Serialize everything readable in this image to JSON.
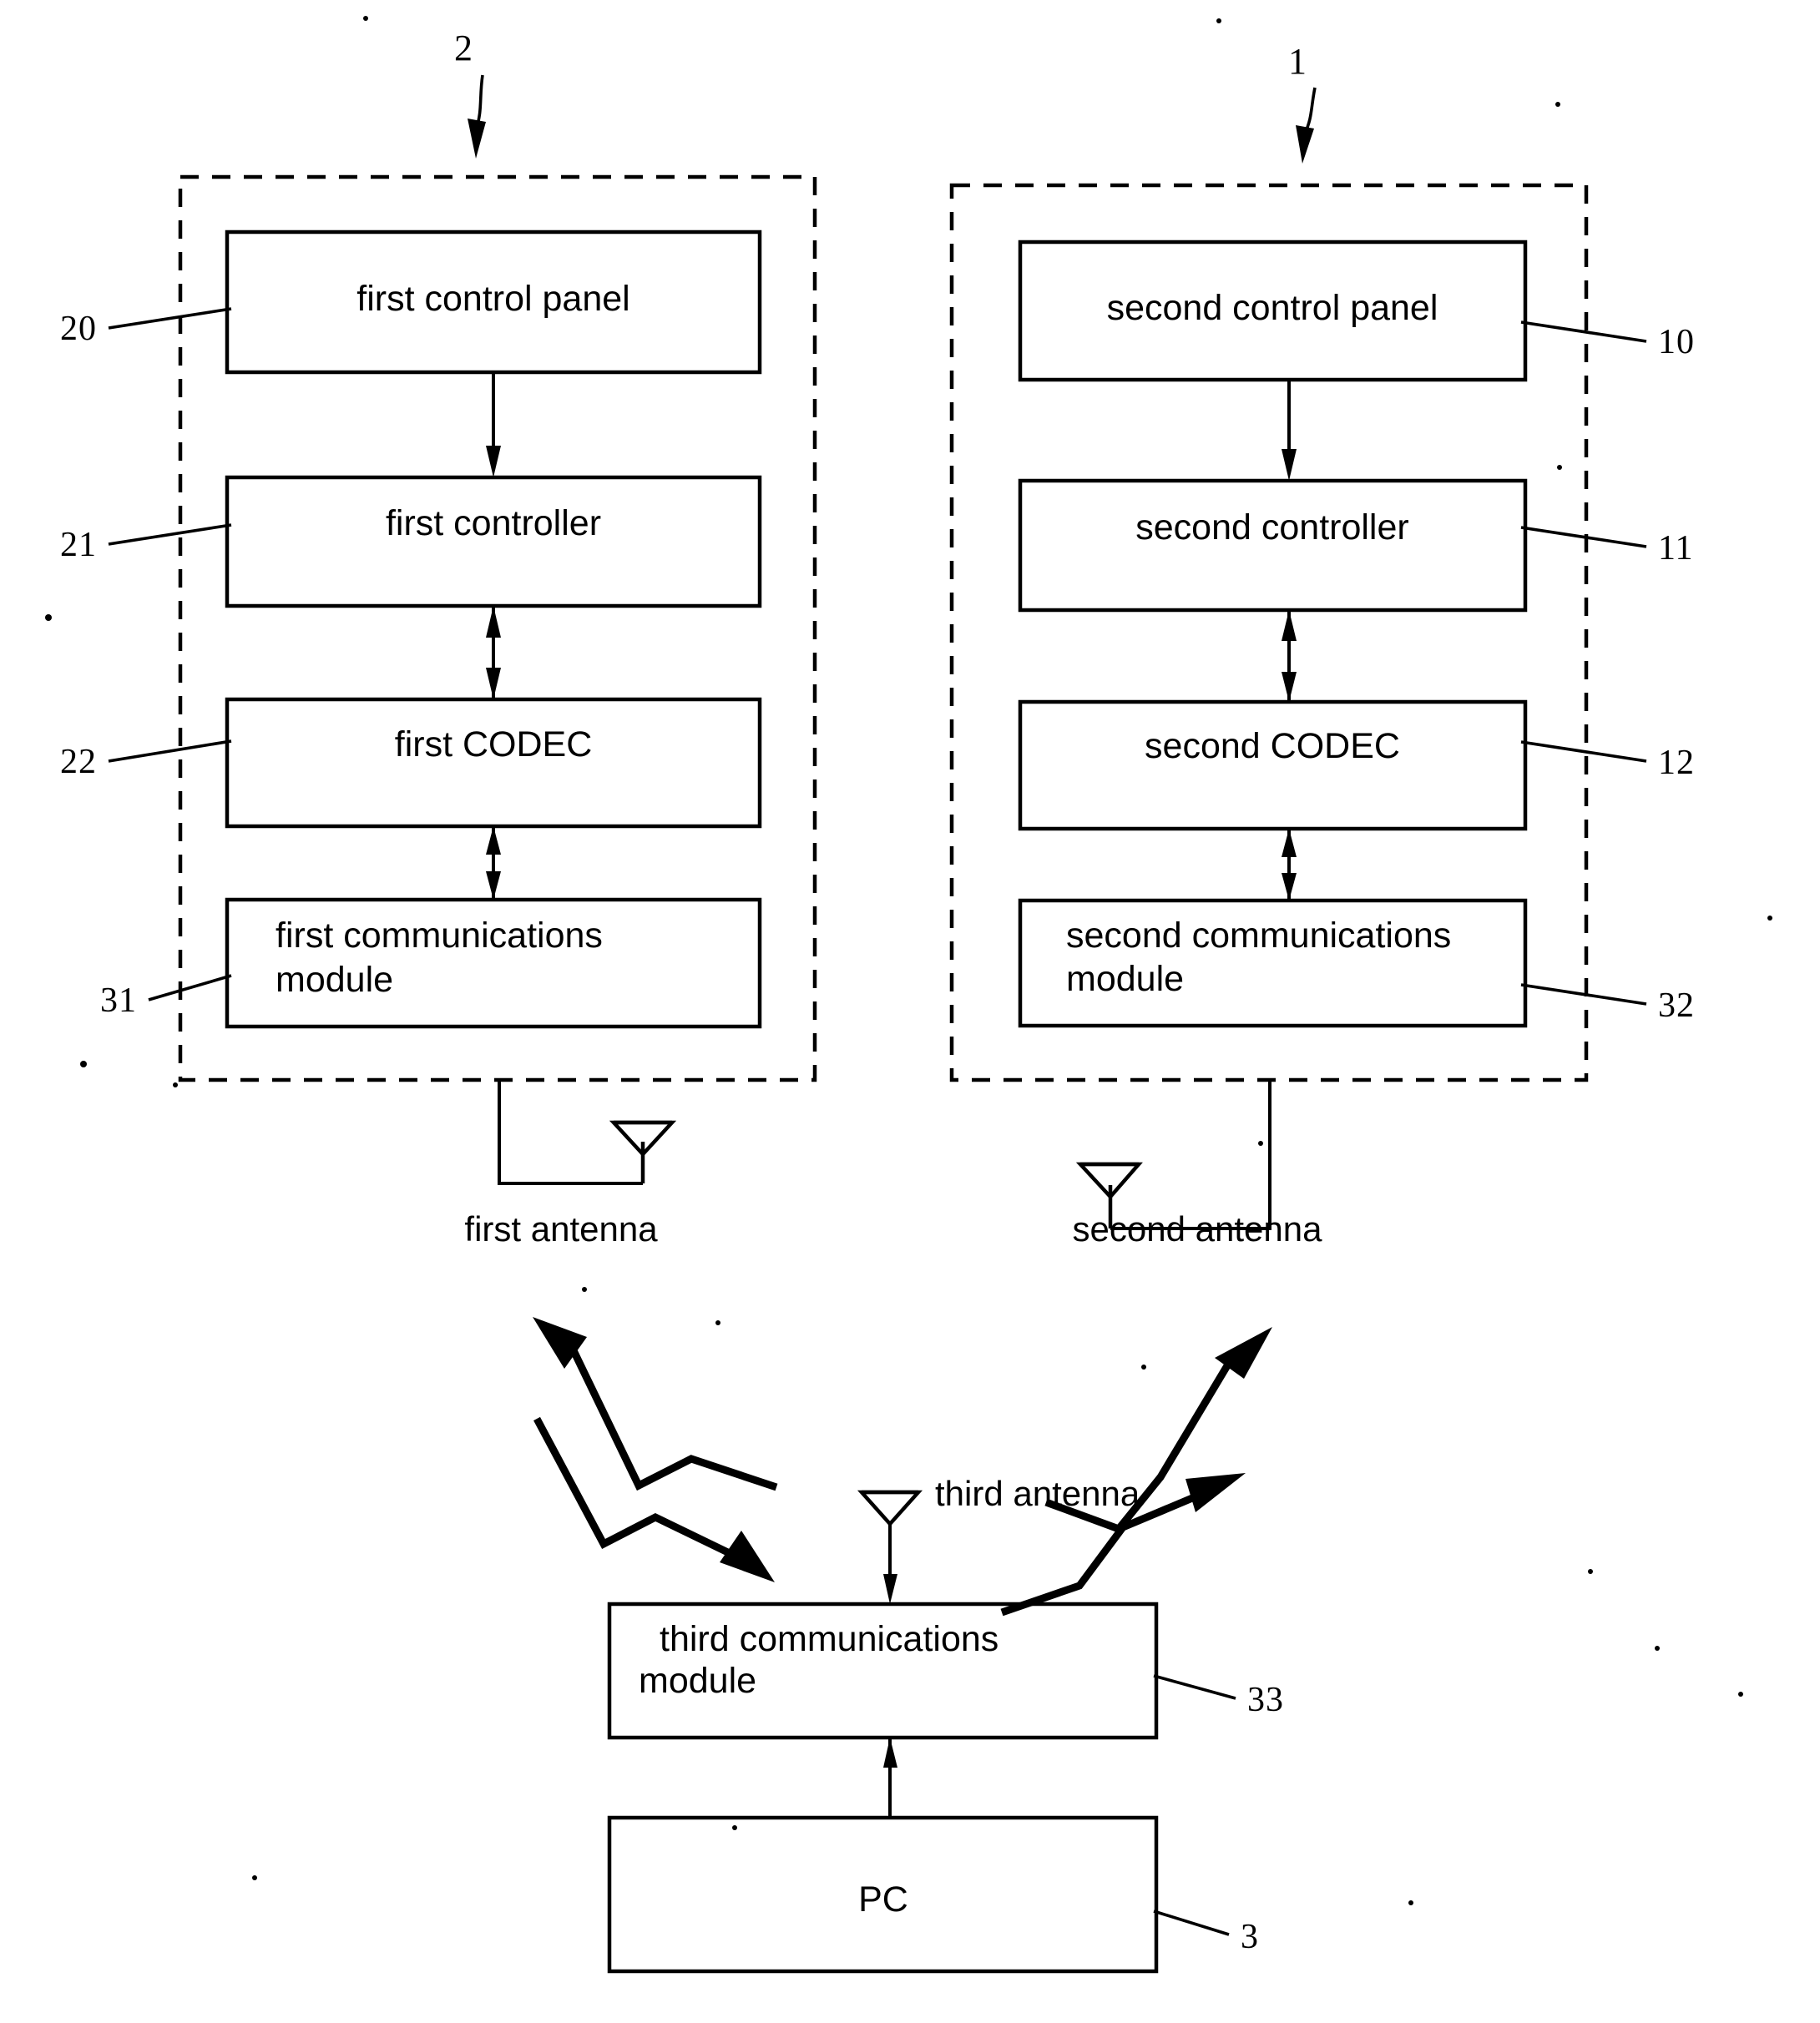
{
  "figure": {
    "type": "patent-block-diagram",
    "background_color": "#ffffff",
    "line_color": "#000000"
  },
  "assemblies": [
    {
      "id": "left-assembly",
      "reference_number": "2",
      "blocks": [
        {
          "id": "first-control-panel",
          "label": "first control panel",
          "reference_number": "20",
          "ref_side": "left"
        },
        {
          "id": "first-controller",
          "label": "first controller",
          "reference_number": "21",
          "ref_side": "left"
        },
        {
          "id": "first-codec",
          "label": "first CODEC",
          "reference_number": "22",
          "ref_side": "left"
        },
        {
          "id": "first-communications-module",
          "label_line1": "first communications",
          "label_line2": "module",
          "reference_number": "31",
          "ref_side": "left"
        }
      ]
    },
    {
      "id": "right-assembly",
      "reference_number": "1",
      "blocks": [
        {
          "id": "second-control-panel",
          "label": "second control panel",
          "reference_number": "10",
          "ref_side": "right"
        },
        {
          "id": "second-controller",
          "label": "second controller",
          "reference_number": "11",
          "ref_side": "right"
        },
        {
          "id": "second-codec",
          "label": "second CODEC",
          "reference_number": "12",
          "ref_side": "right"
        },
        {
          "id": "second-communications-module",
          "label_line1": "second communications",
          "label_line2": "module",
          "reference_number": "32",
          "ref_side": "right"
        }
      ]
    }
  ],
  "antennas": [
    {
      "id": "first-antenna",
      "label": "first antenna"
    },
    {
      "id": "second-antenna",
      "label": "second antenna"
    },
    {
      "id": "third-antenna",
      "label": "third antenna"
    }
  ],
  "base_station": {
    "communications_module": {
      "id": "third-communications-module",
      "label_line1": "third    communications",
      "label_line2": "module",
      "reference_number": "33",
      "ref_side": "right"
    },
    "computer": {
      "id": "pc-block",
      "label": "PC",
      "reference_number": "3",
      "ref_side": "right"
    }
  },
  "connections": [
    {
      "from": "first-control-panel",
      "to": "first-controller",
      "kind": "single-arrow-down"
    },
    {
      "from": "first-controller",
      "to": "first-codec",
      "kind": "double-arrow"
    },
    {
      "from": "first-codec",
      "to": "first-communications-module",
      "kind": "double-arrow"
    },
    {
      "from": "second-control-panel",
      "to": "second-controller",
      "kind": "single-arrow-down"
    },
    {
      "from": "second-controller",
      "to": "second-codec",
      "kind": "double-arrow"
    },
    {
      "from": "second-codec",
      "to": "second-communications-module",
      "kind": "double-arrow"
    },
    {
      "from": "third-antenna",
      "to": "third-communications-module",
      "kind": "single-arrow-down"
    },
    {
      "from": "pc-block",
      "to": "third-communications-module",
      "kind": "single-arrow-up"
    }
  ],
  "radio_links": [
    {
      "id": "link-first-to-third",
      "direction": "downlink"
    },
    {
      "id": "link-third-to-first",
      "direction": "uplink"
    },
    {
      "id": "link-second-to-third",
      "direction": "downlink"
    },
    {
      "id": "link-third-to-second",
      "direction": "uplink"
    }
  ]
}
